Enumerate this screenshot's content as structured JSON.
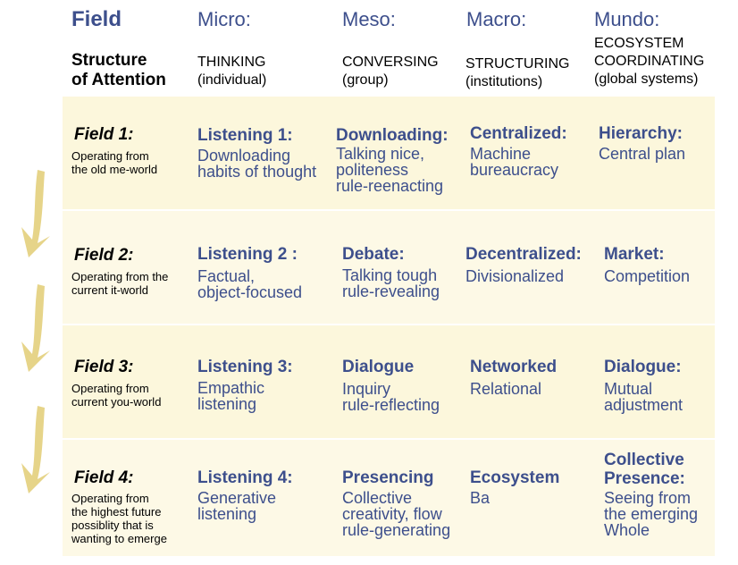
{
  "header": {
    "field": "Field",
    "structure_of_attention": [
      "Structure",
      "of Attention"
    ],
    "columns": [
      {
        "title": "Micro:",
        "sub1": "THINKING",
        "sub2": "(individual)"
      },
      {
        "title": "Meso:",
        "sub1": "CONVERSING",
        "sub2": "(group)"
      },
      {
        "title": "Macro:",
        "sub1": "STRUCTURING",
        "sub2": "(institutions)"
      },
      {
        "title": "Mundo:",
        "sub0": "ECOSYSTEM",
        "sub1": "COORDINATING",
        "sub2": "(global systems)"
      }
    ]
  },
  "rows": [
    {
      "field": "Field 1:",
      "desc": [
        "Operating from",
        "the old me-world"
      ],
      "cells": [
        {
          "title": "Listening 1:",
          "body": [
            "Downloading",
            "habits of thought"
          ]
        },
        {
          "title": "Downloading:",
          "body": [
            "Talking nice,",
            "politeness",
            "rule-reenacting"
          ]
        },
        {
          "title": "Centralized:",
          "body": [
            "Machine",
            "bureaucracy"
          ]
        },
        {
          "title": "Hierarchy:",
          "body": [
            "Central plan"
          ]
        }
      ]
    },
    {
      "field": "Field 2:",
      "desc": [
        "Operating from the",
        "current it-world"
      ],
      "cells": [
        {
          "title": "Listening 2 :",
          "body": [
            "Factual,",
            "object-focused"
          ]
        },
        {
          "title": "Debate:",
          "body": [
            "Talking tough",
            "rule-revealing"
          ]
        },
        {
          "title": "Decentralized:",
          "body": [
            "Divisionalized"
          ]
        },
        {
          "title": "Market:",
          "body": [
            "Competition"
          ]
        }
      ]
    },
    {
      "field": "Field 3:",
      "desc": [
        "Operating from",
        "current you-world"
      ],
      "cells": [
        {
          "title": "Listening 3:",
          "body": [
            "Empathic",
            "listening"
          ]
        },
        {
          "title": "Dialogue",
          "body": [
            "Inquiry",
            "rule-reflecting"
          ]
        },
        {
          "title": "Networked",
          "body": [
            "Relational"
          ]
        },
        {
          "title": "Dialogue:",
          "body": [
            "Mutual",
            "adjustment"
          ]
        }
      ]
    },
    {
      "field": "Field 4:",
      "desc": [
        "Operating from",
        "the highest future",
        "possiblity that is",
        "wanting to emerge"
      ],
      "cells": [
        {
          "title": "Listening 4:",
          "body": [
            "Generative",
            "listening"
          ]
        },
        {
          "title": "Presencing",
          "body": [
            "Collective",
            "creativity, flow",
            "rule-generating"
          ]
        },
        {
          "title": "Ecosystem",
          "body": [
            "Ba"
          ]
        },
        {
          "title": [
            "Collective",
            "Presence:"
          ],
          "body": [
            "Seeing from",
            "the emerging",
            "Whole"
          ]
        }
      ]
    }
  ],
  "colors": {
    "accent": "#3d4f8c",
    "row_bg": "#fcf7dc",
    "arrow": "#e2cc74"
  },
  "icons": [
    "down-arrow-icon"
  ]
}
